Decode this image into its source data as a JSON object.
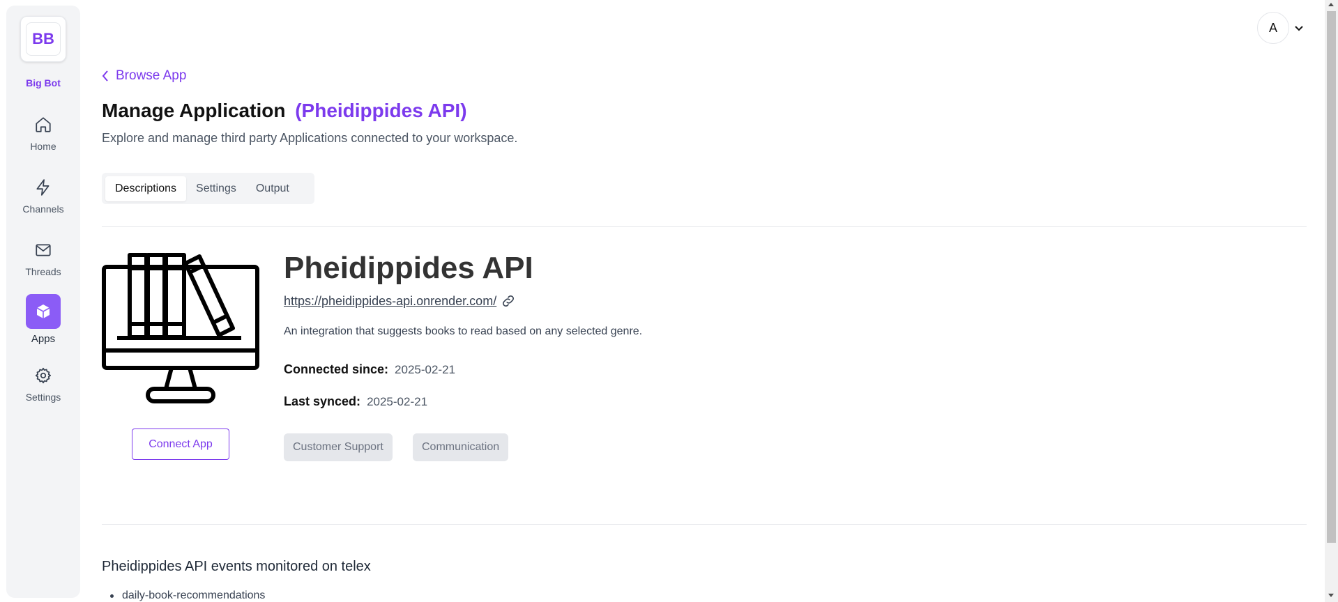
{
  "sidebar": {
    "logo_text": "BB",
    "brand_name": "Big Bot",
    "items": [
      {
        "label": "Home",
        "icon": "home-icon"
      },
      {
        "label": "Channels",
        "icon": "lightning-icon"
      },
      {
        "label": "Threads",
        "icon": "mail-icon"
      },
      {
        "label": "Apps",
        "icon": "cube-icon",
        "active": true
      },
      {
        "label": "Settings",
        "icon": "gear-icon"
      }
    ]
  },
  "header": {
    "avatar_initial": "A"
  },
  "main": {
    "back_label": "Browse App",
    "title": "Manage Application",
    "title_accent": "(Pheidippides API)",
    "subtitle": "Explore and manage third party Applications connected to your workspace.",
    "tabs": [
      {
        "label": "Descriptions",
        "active": true
      },
      {
        "label": "Settings"
      },
      {
        "label": "Output"
      }
    ]
  },
  "app": {
    "name": "Pheidippides API",
    "url": "https://pheidippides-api.onrender.com/",
    "description": "An integration that suggests books to read based on any selected genre.",
    "connected_label": "Connected since:",
    "connected_value": "2025-02-21",
    "synced_label": "Last synced:",
    "synced_value": "2025-02-21",
    "connect_button": "Connect App",
    "tags": [
      "Customer Support",
      "Communication"
    ]
  },
  "events": {
    "title": "Pheidippides API events monitored on telex",
    "items": [
      "daily-book-recommendations"
    ]
  },
  "colors": {
    "accent": "#7c3aed",
    "sidebar_bg": "#f3f4f6",
    "active_tile": "#8b5cf6"
  }
}
